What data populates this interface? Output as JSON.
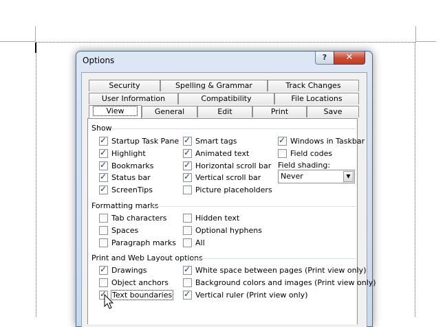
{
  "window": {
    "title": "Options",
    "help_glyph": "?",
    "close_glyph": "✕"
  },
  "tabs": {
    "row1": [
      "Security",
      "Spelling & Grammar",
      "Track Changes"
    ],
    "row2": [
      "User Information",
      "Compatibility",
      "File Locations"
    ],
    "row3": [
      "View",
      "General",
      "Edit",
      "Print",
      "Save"
    ],
    "active": "View"
  },
  "show": {
    "title": "Show",
    "col1": [
      {
        "label": "Startup Task Pane",
        "checked": true
      },
      {
        "label": "Highlight",
        "checked": true
      },
      {
        "label": "Bookmarks",
        "checked": true
      },
      {
        "label": "Status bar",
        "checked": true
      },
      {
        "label": "ScreenTips",
        "checked": true
      }
    ],
    "col2": [
      {
        "label": "Smart tags",
        "checked": true
      },
      {
        "label": "Animated text",
        "checked": true
      },
      {
        "label": "Horizontal scroll bar",
        "checked": true
      },
      {
        "label": "Vertical scroll bar",
        "checked": true
      },
      {
        "label": "Picture placeholders",
        "checked": false
      }
    ],
    "col3": [
      {
        "label": "Windows in Taskbar",
        "checked": true
      },
      {
        "label": "Field codes",
        "checked": false
      }
    ],
    "field_shading_label": "Field shading:",
    "field_shading_value": "Never"
  },
  "formatting": {
    "title": "Formatting marks",
    "col1": [
      {
        "label": "Tab characters",
        "checked": false
      },
      {
        "label": "Spaces",
        "checked": false
      },
      {
        "label": "Paragraph marks",
        "checked": false
      }
    ],
    "col2": [
      {
        "label": "Hidden text",
        "checked": false
      },
      {
        "label": "Optional hyphens",
        "checked": false
      },
      {
        "label": "All",
        "checked": false
      }
    ]
  },
  "print_web": {
    "title": "Print and Web Layout options",
    "col1": [
      {
        "label": "Drawings",
        "checked": true
      },
      {
        "label": "Object anchors",
        "checked": false
      },
      {
        "label": "Text boundaries",
        "checked": true
      }
    ],
    "col2": [
      {
        "label": "White space between pages (Print view only)",
        "checked": true
      },
      {
        "label": "Background colors and images (Print view only)",
        "checked": false
      },
      {
        "label": "Vertical ruler (Print view only)",
        "checked": true
      }
    ]
  },
  "check_glyph": "✓",
  "colors": {
    "accent": "#223e6d",
    "title_bar": "#c9d9ec",
    "close": "#c74a34"
  }
}
